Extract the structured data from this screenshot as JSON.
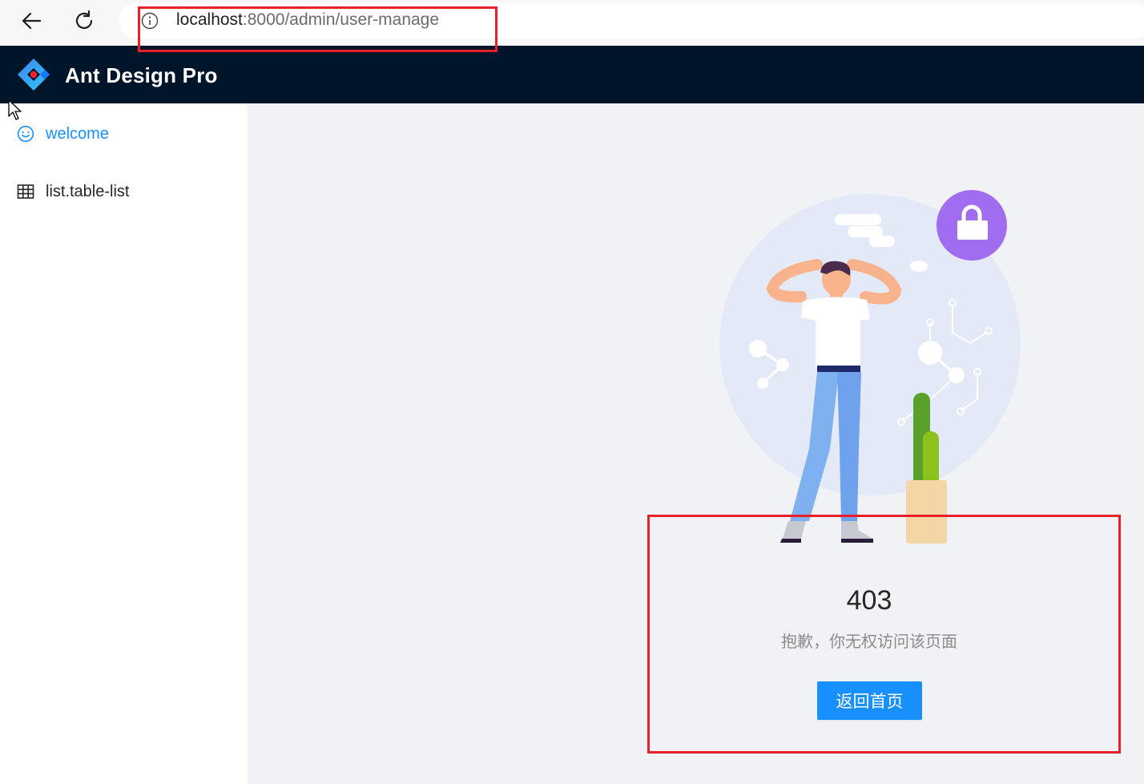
{
  "browser": {
    "url_host": "localhost",
    "url_path": ":8000/admin/user-manage",
    "back_icon": "arrow-left-icon",
    "reload_icon": "reload-icon",
    "info_icon": "info-circle-icon"
  },
  "header": {
    "title": "Ant Design Pro",
    "logo": "ant-design-logo",
    "background": "#001529"
  },
  "sidebar": {
    "items": [
      {
        "label": "welcome",
        "icon": "smile-icon",
        "active": true,
        "color": "#1890ff"
      },
      {
        "label": "list.table-list",
        "icon": "table-icon",
        "active": false,
        "color": "#262626"
      }
    ]
  },
  "result": {
    "status": "403",
    "subtitle": "抱歉，你无权访问该页面",
    "button_label": "返回首页",
    "illustration": "403-illustration-person-with-lock",
    "button_color": "#1890ff"
  },
  "annotations": {
    "color": "#e8202a"
  }
}
